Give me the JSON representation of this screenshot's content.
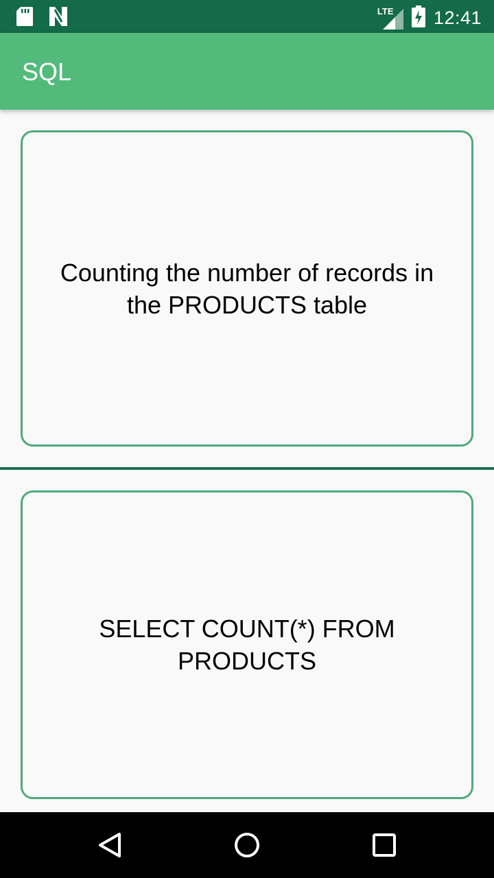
{
  "status_bar": {
    "time": "12:41",
    "network": "LTE",
    "icons": [
      "sd-card-icon",
      "n-notification-icon",
      "lte-signal-icon",
      "battery-charging-icon"
    ]
  },
  "app_bar": {
    "title": "SQL"
  },
  "question_card": {
    "text": "Counting the number of records in the PRODUCTS table"
  },
  "answer_card": {
    "text": "SELECT COUNT(*) FROM PRODUCTS"
  },
  "nav_bar": {
    "icons": [
      "back-icon",
      "home-icon",
      "recents-icon"
    ]
  },
  "colors": {
    "status_bar": "#136b4a",
    "app_bar": "#52bb7b",
    "card_border": "#4fa97c",
    "divider": "#1f6b50",
    "background": "#f9f9f9"
  }
}
